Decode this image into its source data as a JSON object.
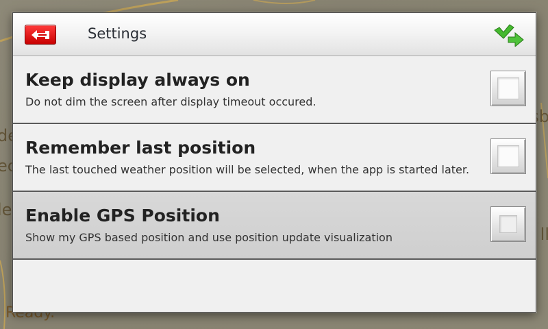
{
  "dialog": {
    "title": "Settings",
    "back_icon": "back-arrow-icon",
    "confirm_icon": "checkmark-arrow-icon"
  },
  "settings": [
    {
      "title": "Keep display always on",
      "description": "Do not dim the screen after display timeout occured.",
      "checked": false
    },
    {
      "title": "Remember last position",
      "description": "The last touched weather position will be selected, when the app is started later.",
      "checked": false
    },
    {
      "title": "Enable GPS Position",
      "description": "Show my GPS based position and use position update visualization",
      "checked": false,
      "pressed": true
    }
  ],
  "background": {
    "status": "Ready.",
    "map_fragments_left": [
      "de",
      "ec",
      "le"
    ],
    "map_fragments_right": [
      "sb",
      "ll"
    ]
  },
  "colors": {
    "back_button": "#e00000",
    "confirm_icon": "#3cb82c",
    "dialog_bg": "#f0f0f0"
  }
}
